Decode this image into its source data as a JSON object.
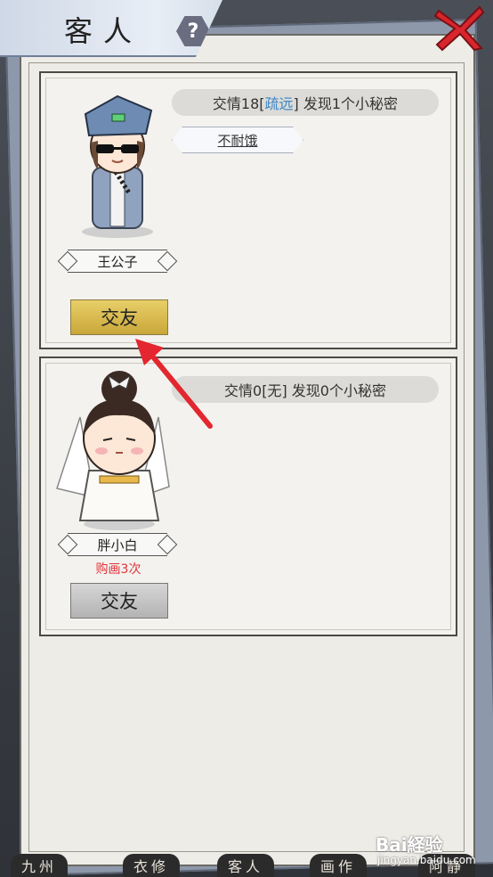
{
  "header": {
    "title": "客人",
    "help_icon": "question-icon",
    "close_icon": "close-icon"
  },
  "guests": [
    {
      "friendship_text_pre": "交情18[",
      "friendship_level": "疏远",
      "friendship_text_post": "] 发现1个小秘密",
      "trait_tag": "不耐饿",
      "name": "王公子",
      "button_label": "交友",
      "button_state": "gold"
    },
    {
      "friendship_text": "交情0[无] 发现0个小秘密",
      "name": "胖小白",
      "note": "购画3次",
      "button_label": "交友",
      "button_state": "grey"
    }
  ],
  "bottom_tabs": [
    "九州",
    "衣修",
    "客人",
    "画作",
    "阿静"
  ],
  "watermark": {
    "brand": "Bai経验",
    "url": "jingyan.baidu.com"
  },
  "colors": {
    "highlight": "#3d86c6",
    "note_red": "#e0333a",
    "gold_button": "#d8bb50",
    "arrow": "#e3262f"
  }
}
